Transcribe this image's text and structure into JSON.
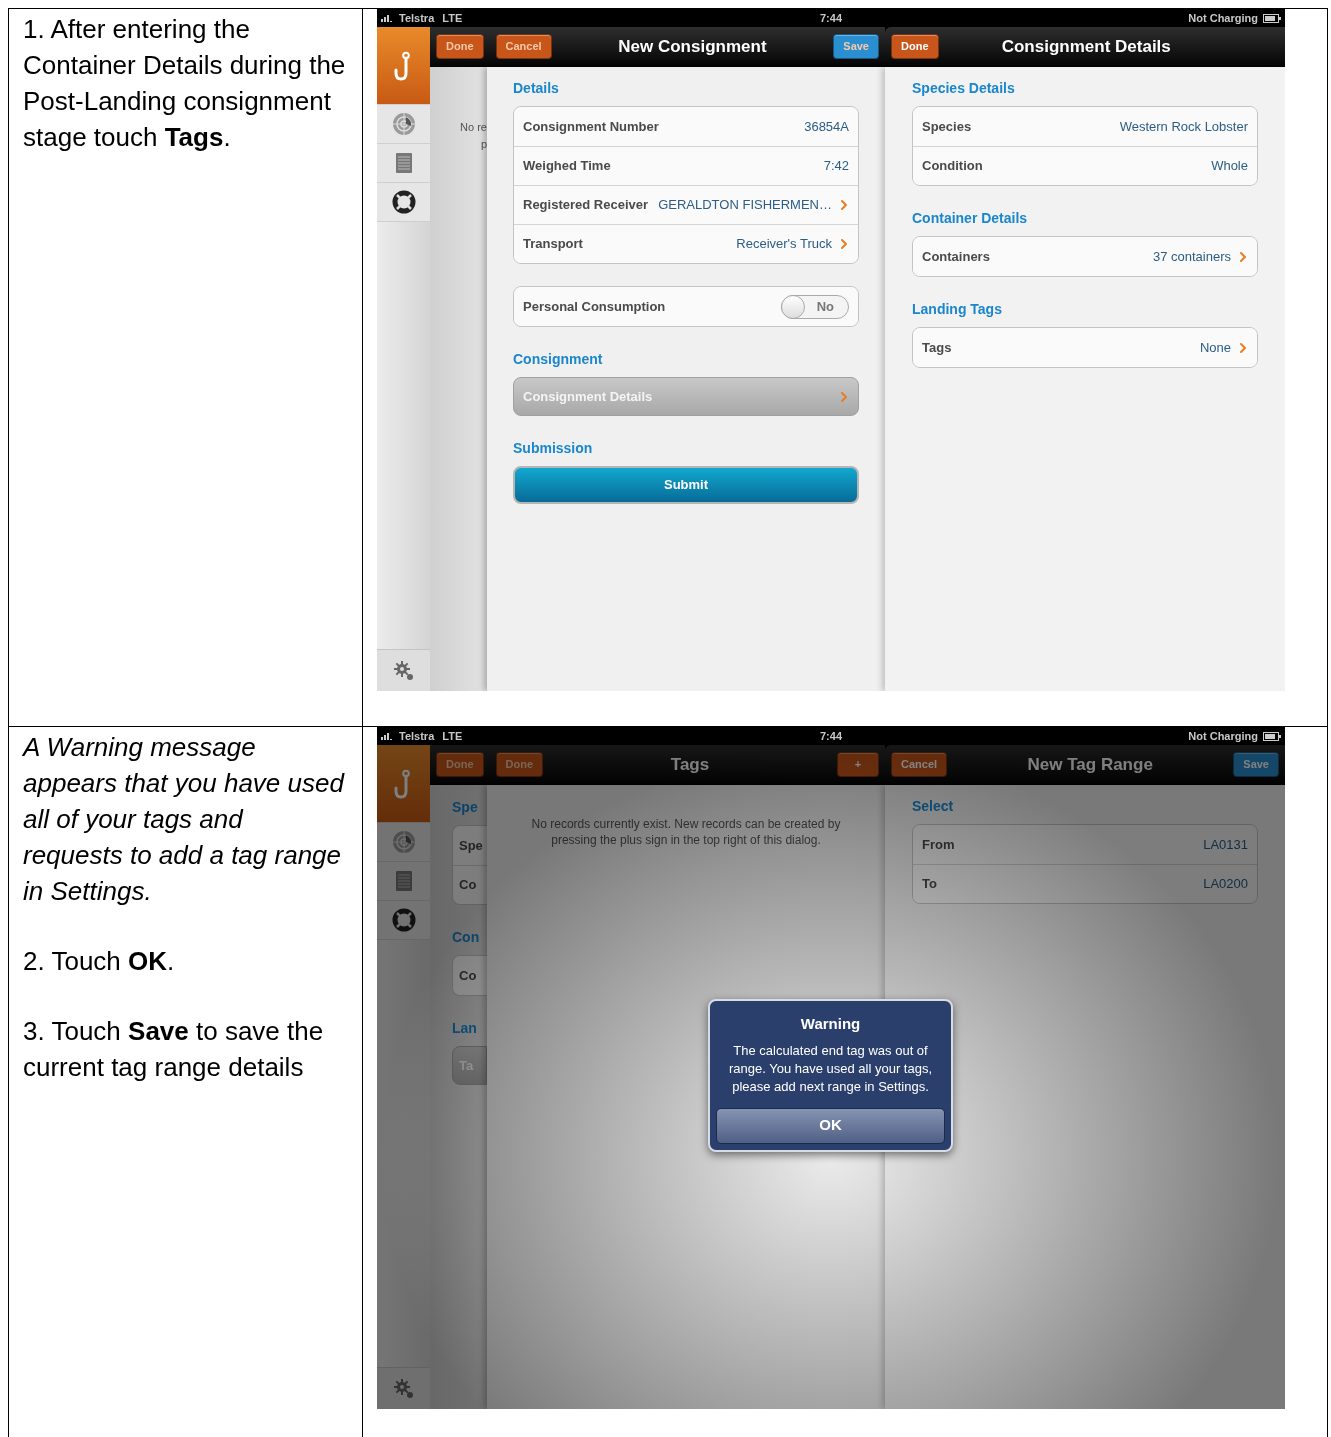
{
  "steps": [
    {
      "instruction": [
        {
          "kind": "step",
          "text": "1. After entering the Container Details during the Post-Landing consignment stage touch **Tags**."
        }
      ],
      "screen": {
        "status_bar": {
          "carrier": "Telstra",
          "network": "LTE",
          "time": "7:44",
          "battery": "Not Charging"
        },
        "sidebar": [
          {
            "selected": true
          },
          {
            "selected": false
          },
          {
            "selected": false
          },
          {
            "selected": false
          }
        ],
        "dimmed": false,
        "master": {
          "header": {
            "left": [
              {
                "label": "Done",
                "kind": "orange",
                "disabled": true
              },
              {
                "label": "Cancel",
                "kind": "orange",
                "disabled": true
              }
            ],
            "title": "New Consignment",
            "right": [
              {
                "label": "Save",
                "kind": "blue",
                "disabled": true
              }
            ]
          },
          "back_pane": [
            {
              "kind": "text",
              "lines": [
                "No re",
                "p"
              ]
            }
          ],
          "sections": [
            {
              "heading": "Details",
              "kind": "group",
              "rows": [
                {
                  "kind": "value",
                  "label": "Consignment Number",
                  "value": "36854A",
                  "disclosure": false
                },
                {
                  "kind": "value",
                  "label": "Weighed Time",
                  "value": "7:42",
                  "disclosure": false
                },
                {
                  "kind": "value",
                  "label": "Registered Receiver",
                  "value": "GERALDTON FISHERMEN…",
                  "disclosure": true
                },
                {
                  "kind": "value",
                  "label": "Transport",
                  "value": "Receiver's Truck",
                  "disclosure": true
                }
              ]
            },
            {
              "kind": "group",
              "rows": [
                {
                  "kind": "toggle",
                  "label": "Personal Consumption",
                  "value": "No",
                  "on": false
                }
              ]
            },
            {
              "heading": "Consignment",
              "kind": "nav_button",
              "label": "Consignment Details"
            },
            {
              "heading": "Submission",
              "kind": "submit",
              "label": "Submit"
            }
          ]
        },
        "detail": {
          "header": {
            "left": [
              {
                "label": "Done",
                "kind": "orange",
                "disabled": false
              }
            ],
            "title": "Consignment Details"
          },
          "sections": [
            {
              "heading": "Species Details",
              "kind": "group",
              "rows": [
                {
                  "kind": "value",
                  "label": "Species",
                  "value": "Western Rock Lobster",
                  "disclosure": false
                },
                {
                  "kind": "value",
                  "label": "Condition",
                  "value": "Whole",
                  "disclosure": false
                }
              ]
            },
            {
              "heading": "Container Details",
              "kind": "group",
              "rows": [
                {
                  "kind": "value",
                  "label": "Containers",
                  "value": "37 containers",
                  "disclosure": true
                }
              ]
            },
            {
              "heading": "Landing Tags",
              "kind": "group",
              "rows": [
                {
                  "kind": "value",
                  "label": "Tags",
                  "value": "None",
                  "disclosure": true
                }
              ]
            }
          ]
        }
      }
    },
    {
      "instruction": [
        {
          "kind": "note",
          "text": "A Warning message appears that you have used all of your tags and requests to add a tag range in Settings."
        },
        {
          "kind": "step",
          "text": "2. Touch **OK**."
        },
        {
          "kind": "step",
          "text": "3. Touch **Save** to save the current tag range details"
        }
      ],
      "screen": {
        "status_bar": {
          "carrier": "Telstra",
          "network": "LTE",
          "time": "7:44",
          "battery": "Not Charging"
        },
        "sidebar": [
          {
            "selected": true
          },
          {
            "selected": false
          },
          {
            "selected": false
          },
          {
            "selected": false
          }
        ],
        "dimmed": true,
        "master": {
          "header": {
            "left": [
              {
                "label": "Done",
                "kind": "orange",
                "disabled": true
              },
              {
                "label": "Done",
                "kind": "orange",
                "disabled": true
              }
            ],
            "title": "Tags",
            "right": [
              {
                "label": "+",
                "kind": "orange",
                "disabled": false
              }
            ]
          },
          "back_pane": [
            {
              "heading": "Spe",
              "kind": "group",
              "rows": [
                {
                  "label": "Spe"
                },
                {
                  "label": "Co"
                }
              ]
            },
            {
              "heading": "Con",
              "kind": "group",
              "rows": [
                {
                  "label": "Co"
                }
              ]
            },
            {
              "heading": "Lan",
              "kind": "nav_button",
              "label": "Ta"
            }
          ],
          "sections": [
            {
              "kind": "message",
              "text": "No records currently exist. New records can be created by pressing the plus sign in the top right of this dialog."
            }
          ]
        },
        "detail": {
          "header": {
            "left": [
              {
                "label": "Cancel",
                "kind": "orange",
                "disabled": false
              }
            ],
            "title": "New Tag Range",
            "right": [
              {
                "label": "Save",
                "kind": "blue",
                "disabled": false
              }
            ]
          },
          "sections": [
            {
              "heading": "Select",
              "kind": "group",
              "rows": [
                {
                  "kind": "value",
                  "label": "From",
                  "value": "LA0131",
                  "disclosure": false
                },
                {
                  "kind": "value",
                  "label": "To",
                  "value": "LA0200",
                  "disclosure": false
                }
              ]
            }
          ]
        },
        "alert": {
          "title": "Warning",
          "message": "The calculated end tag was out of range. You have used all your tags, please add next range in Settings.",
          "buttons": [
            "OK"
          ]
        }
      }
    }
  ]
}
